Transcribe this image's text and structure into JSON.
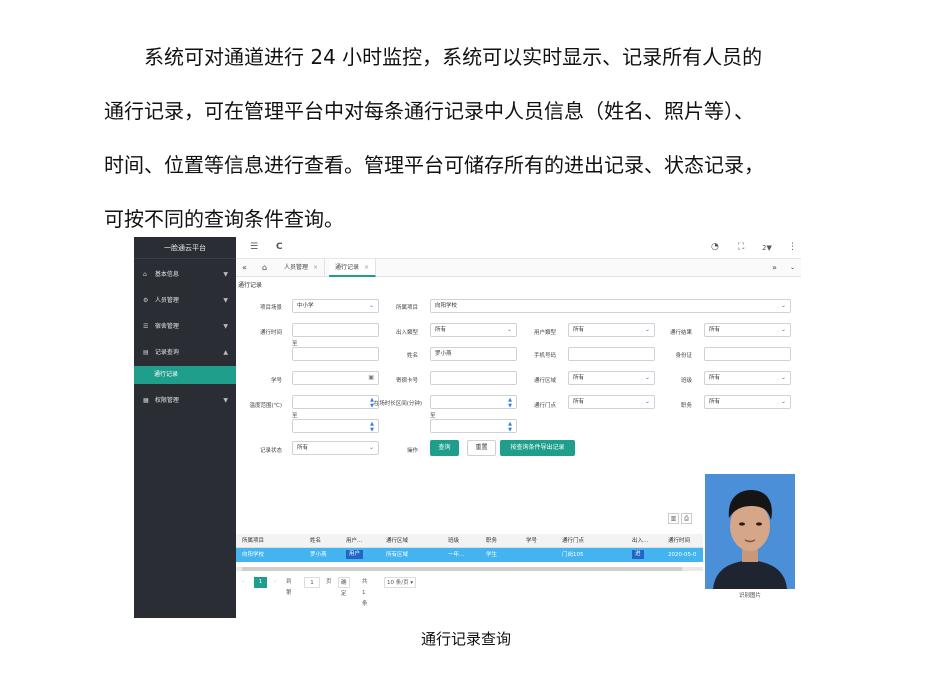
{
  "paragraph": {
    "lines": [
      "系统可对通道进行 24 小时监控，系统可以实时显示、记录所有人员的",
      "通行记录，可在管理平台中对每条通行记录中人员信息（姓名、照片等）、",
      "时间、位置等信息进行查看。管理平台可储存所有的进出记录、状态记录，",
      "可按不同的查询条件查询。"
    ]
  },
  "caption": "通行记录查询",
  "app": {
    "brand": "一脸通云平台",
    "sidebar": {
      "items": [
        {
          "icon": "home-icon",
          "glyph": "⌂",
          "label": "基本信息"
        },
        {
          "icon": "gear-icon",
          "glyph": "⚙",
          "label": "人员管理"
        },
        {
          "icon": "database-icon",
          "glyph": "☰",
          "label": "宿舍管理"
        },
        {
          "icon": "chart-icon",
          "glyph": "▤",
          "label": "记录查询"
        },
        {
          "icon": "grid-icon",
          "glyph": "▦",
          "label": "权限管理"
        }
      ],
      "active_sub": "通行记录"
    },
    "topbar": {
      "refresh": "C",
      "menu": "☰",
      "count": "2▼"
    },
    "tabs": [
      {
        "label": "人员管理",
        "close": "×"
      },
      {
        "label": "通行记录",
        "close": "×"
      }
    ],
    "panel_title": "通行记录",
    "form": {
      "project_venue_label": "项目场景",
      "project_venue_value": "中小学",
      "project_label": "所属项目",
      "project_value": "向阳学校",
      "time_label": "通行时间",
      "to": "至",
      "direction_label": "出入類型",
      "direction_value": "所有",
      "user_type_label": "用户類型",
      "user_type_value": "所有",
      "result_label": "通行结果",
      "result_value": "所有",
      "name_label": "姓名",
      "name_value": "罗小燕",
      "phone_label": "手机号码",
      "id_label": "身份证",
      "student_no_label": "学号",
      "dorm_card_label": "寄宿卡号",
      "area_label": "通行区域",
      "area_value": "所有",
      "class_label": "班级",
      "class_value": "所有",
      "temp_label": "温度范围(℃)",
      "stay_label": "在场时长区间(分钟)",
      "gate_label": "通行门点",
      "gate_value": "所有",
      "duty_label": "职务",
      "duty_value": "所有",
      "state_label": "记录状态",
      "state_value": "所有",
      "op_label": "操作",
      "btn_query": "查询",
      "btn_reset": "重置",
      "btn_export": "按查询条件导出记录"
    },
    "table": {
      "headers": [
        "所属项目",
        "姓名",
        "用户...",
        "通行区域",
        "班级",
        "职务",
        "学号",
        "通行门点",
        "出入...",
        "通行时间"
      ],
      "row": [
        "向阳学校",
        "罗小燕",
        "用户",
        "所有区域",
        "一年...",
        "学生",
        "",
        "门岗105",
        "进",
        "2020-05-0"
      ]
    },
    "pager": {
      "page": "1",
      "goto": "到第",
      "page_input": "1",
      "page_unit": "页",
      "confirm": "确定",
      "total": "共 1 条",
      "per_page": "10 条/页 ▾"
    },
    "photo_caption": "识别图片"
  }
}
